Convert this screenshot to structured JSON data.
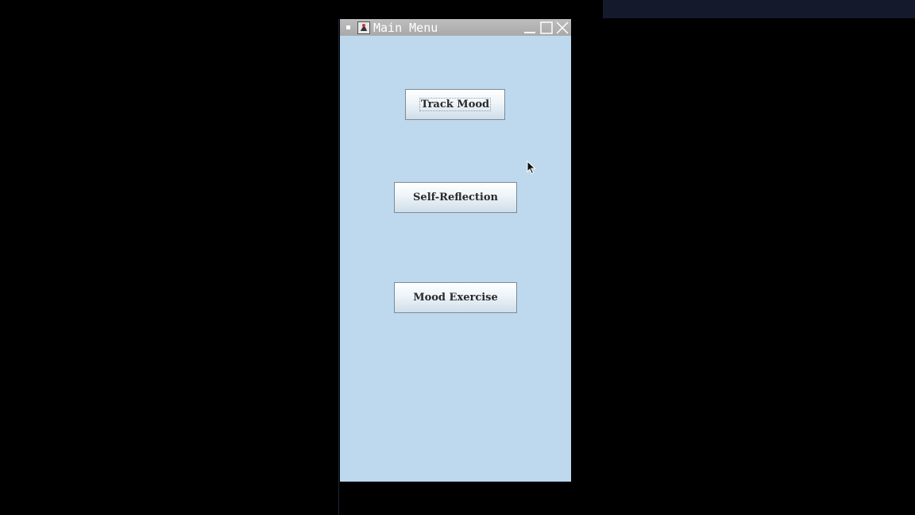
{
  "window": {
    "title": "Main Menu",
    "background_color": "#bed9ee",
    "controls": {
      "minimize_icon": "minimize-icon",
      "maximize_icon": "maximize-icon",
      "close_icon": "close-icon"
    }
  },
  "main": {
    "buttons": [
      {
        "label": "Track Mood",
        "focused": true
      },
      {
        "label": "Self-Reflection",
        "focused": false
      },
      {
        "label": "Mood Exercise",
        "focused": false
      }
    ]
  },
  "colors": {
    "desktop": "#000000",
    "titlebar": "#b3b3b3",
    "top_panel": "#141a2c"
  }
}
